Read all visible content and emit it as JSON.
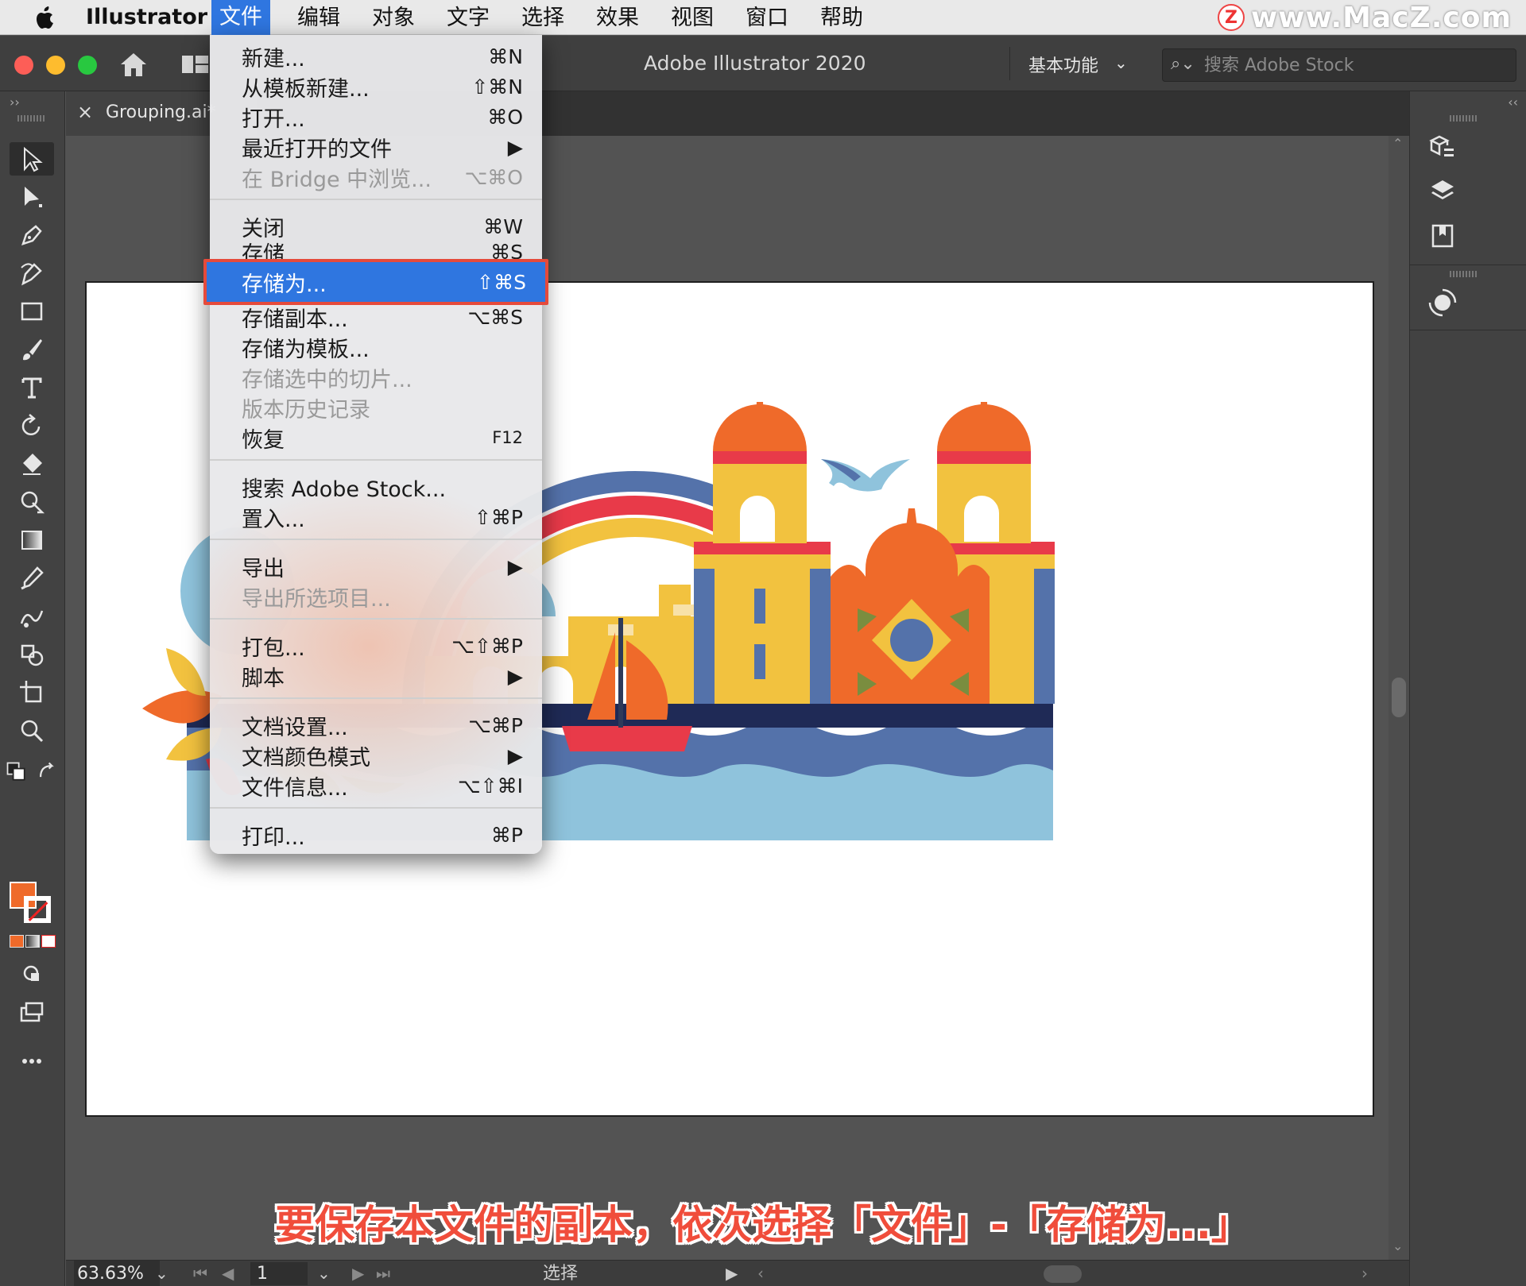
{
  "menubar": {
    "app_name": "Illustrator",
    "items": [
      "文件",
      "编辑",
      "对象",
      "文字",
      "选择",
      "效果",
      "视图",
      "窗口",
      "帮助"
    ],
    "active_item": "文件"
  },
  "watermark": {
    "logo_letter": "Z",
    "text": "www.MacZ.com"
  },
  "titlebar": {
    "title": "Adobe Illustrator 2020",
    "workspace": "基本功能",
    "search_placeholder": "搜索 Adobe Stock"
  },
  "document_tab": {
    "name": "Grouping.ai*",
    "close_glyph": "×"
  },
  "file_menu": {
    "groups": [
      [
        {
          "label": "新建...",
          "shortcut": "⌘N",
          "disabled": false
        },
        {
          "label": "从模板新建...",
          "shortcut": "⇧⌘N",
          "disabled": false
        },
        {
          "label": "打开...",
          "shortcut": "⌘O",
          "disabled": false
        },
        {
          "label": "最近打开的文件",
          "shortcut": "▶",
          "disabled": false
        },
        {
          "label": "在 Bridge 中浏览...",
          "shortcut": "⌥⌘O",
          "disabled": true
        }
      ],
      [
        {
          "label": "关闭",
          "shortcut": "⌘W",
          "disabled": false
        },
        {
          "label": "存储",
          "shortcut": "⌘S",
          "disabled": false
        },
        {
          "label": "存储为...",
          "shortcut": "⇧⌘S",
          "disabled": false,
          "highlighted": true
        },
        {
          "label": "存储副本...",
          "shortcut": "⌥⌘S",
          "disabled": false
        },
        {
          "label": "存储为模板...",
          "shortcut": "",
          "disabled": false
        },
        {
          "label": "存储选中的切片...",
          "shortcut": "",
          "disabled": true
        },
        {
          "label": "版本历史记录",
          "shortcut": "",
          "disabled": true
        },
        {
          "label": "恢复",
          "shortcut": "F12",
          "disabled": false
        }
      ],
      [
        {
          "label": "搜索 Adobe Stock...",
          "shortcut": "",
          "disabled": false
        },
        {
          "label": "置入...",
          "shortcut": "⇧⌘P",
          "disabled": false
        }
      ],
      [
        {
          "label": "导出",
          "shortcut": "▶",
          "disabled": false
        },
        {
          "label": "导出所选项目...",
          "shortcut": "",
          "disabled": true
        }
      ],
      [
        {
          "label": "打包...",
          "shortcut": "⌥⇧⌘P",
          "disabled": false
        },
        {
          "label": "脚本",
          "shortcut": "▶",
          "disabled": false
        }
      ],
      [
        {
          "label": "文档设置...",
          "shortcut": "⌥⌘P",
          "disabled": false
        },
        {
          "label": "文档颜色模式",
          "shortcut": "▶",
          "disabled": false
        },
        {
          "label": "文件信息...",
          "shortcut": "⌥⇧⌘I",
          "disabled": false
        }
      ],
      [
        {
          "label": "打印...",
          "shortcut": "⌘P",
          "disabled": false
        }
      ]
    ]
  },
  "statusbar": {
    "zoom": "63.63%",
    "page": "1",
    "status": "选择"
  },
  "caption": "要保存本文件的副本，依次选择「文件」-「存储为...」",
  "colors": {
    "menu_highlight": "#2f76e0",
    "highlight_border": "#e54a3b",
    "fill_swatch": "#ef6a2a",
    "caption": "#f04d3b"
  }
}
